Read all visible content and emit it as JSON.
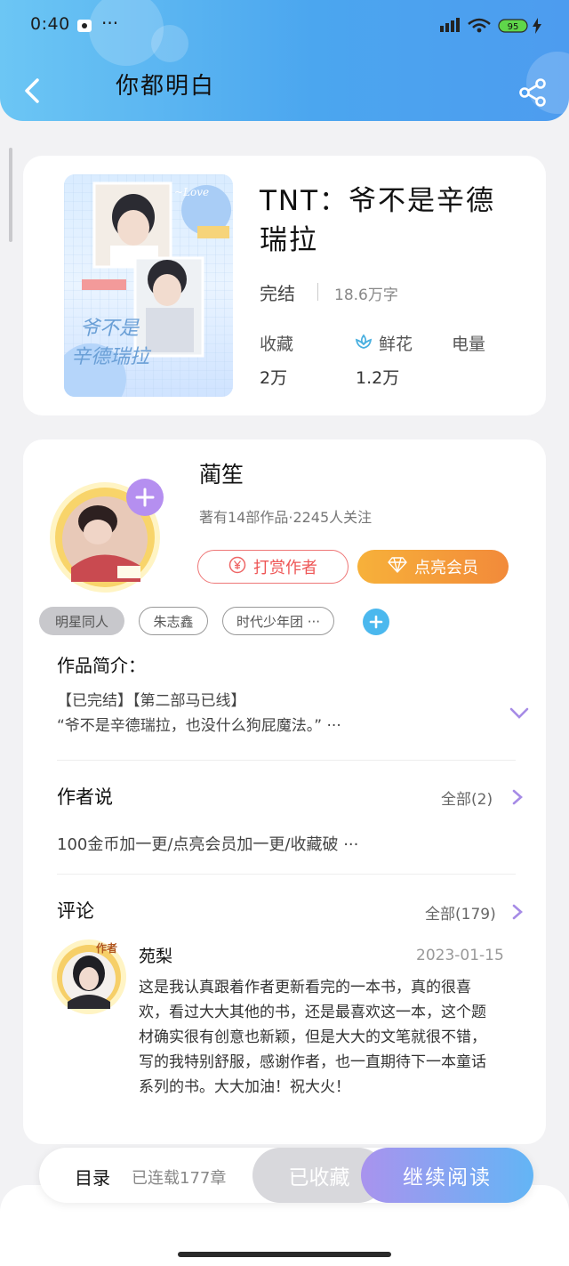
{
  "status_bar": {
    "time": "0:40",
    "dots": "···",
    "battery": "95"
  },
  "nav": {
    "title": "你都明白"
  },
  "book": {
    "title": "TNT：爷不是辛德瑞拉",
    "status": "完结",
    "word_count": "18.6万字",
    "stats": [
      {
        "label": "收藏",
        "value": "2万"
      },
      {
        "label": "鲜花",
        "value": "1.2万"
      },
      {
        "label": "电量",
        "value": ""
      }
    ]
  },
  "author": {
    "name": "蔺笙",
    "meta": "著有14部作品·2245人关注",
    "tip_button": "打赏作者",
    "vip_button": "点亮会员"
  },
  "tags": [
    "明星同人",
    "朱志鑫",
    "时代少年团 ···"
  ],
  "intro": {
    "title": "作品简介：",
    "line1": "【已完结】【第二部马已线】",
    "line2": "“爷不是辛德瑞拉，也没什么狗屁魔法。” ···"
  },
  "author_says": {
    "title": "作者说",
    "all": "全部(2)",
    "text": "100金币加一更/点亮会员加一更/收藏破 ···"
  },
  "comments": {
    "title": "评论",
    "all": "全部(179)",
    "items": [
      {
        "user": "苑梨",
        "badge": "作者",
        "date": "2023-01-15",
        "text": "这是我认真跟着作者更新看完的一本书，真的很喜欢，看过大大其他的书，还是最喜欢这一本，这个题材确实很有创意也新颖，但是大大的文笔就很不错，写的我特别舒服，感谢作者，也一直期待下一本童话系列的书。大大加油！祝大火！"
      }
    ]
  },
  "bottom": {
    "catalog": "目录",
    "chapters": "已连载177章",
    "collected": "已收藏",
    "continue": "继续阅读"
  },
  "colors": {
    "header_start": "#6cc6f4",
    "header_end": "#4d9cef",
    "vip": "#f28a3a",
    "tip": "#e55555",
    "accent_purple": "#a993ee"
  }
}
